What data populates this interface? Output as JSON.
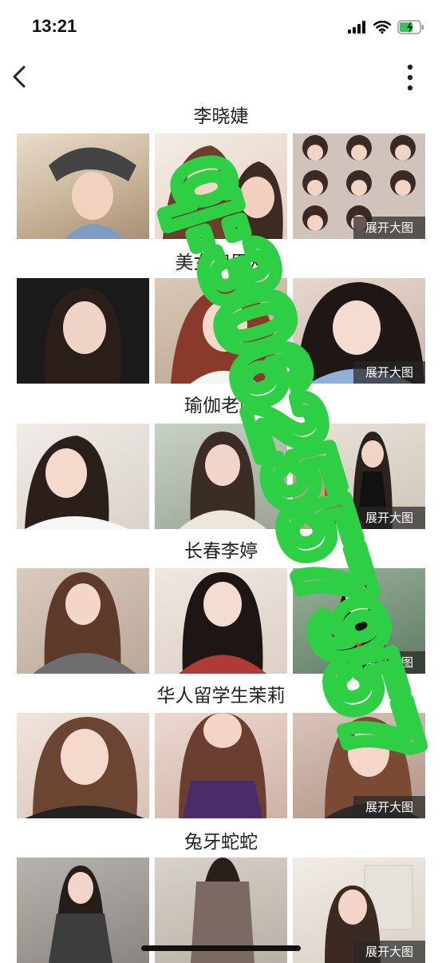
{
  "status_bar": {
    "time": "13:21"
  },
  "sections": [
    {
      "title": "李晓婕",
      "expand_label": "展开大图"
    },
    {
      "title": "美女和男友",
      "expand_label": "展开大图"
    },
    {
      "title": "瑜伽老师",
      "expand_label": "展开大图"
    },
    {
      "title": "长春李婷",
      "expand_label": "展开大图"
    },
    {
      "title": "华人留学生茉莉",
      "expand_label": "展开大图"
    },
    {
      "title": "兔牙蛇蛇",
      "expand_label": "展开大图"
    }
  ],
  "watermark": {
    "text": "q:3062557957"
  },
  "colors": {
    "accent_watermark": "#2fcf45",
    "battery_charging": "#34c759"
  }
}
